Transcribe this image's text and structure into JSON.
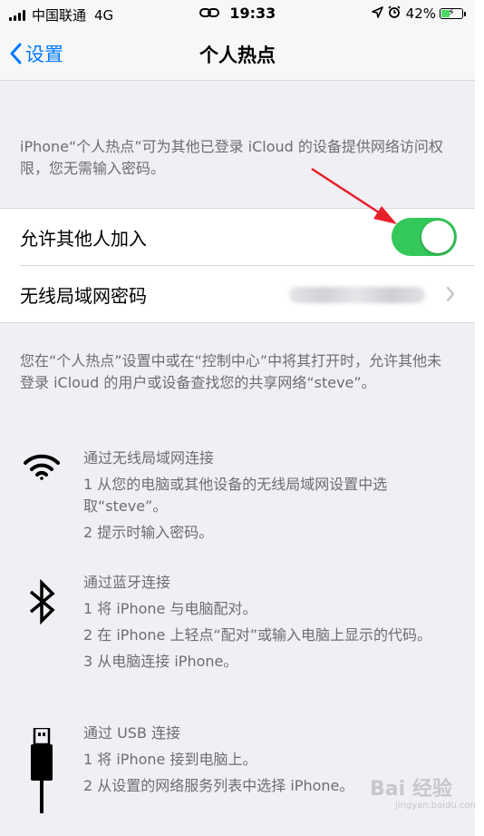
{
  "status_bar": {
    "carrier": "中国联通",
    "network": "4G",
    "time": "19:33",
    "battery": "42%",
    "battery_level": 0.42
  },
  "nav": {
    "back_label": "设置",
    "title": "个人热点"
  },
  "description_top": "iPhone“个人热点”可为其他已登录 iCloud 的设备提供网络访问权限，您无需输入密码。",
  "settings": {
    "allow_others_label": "允许其他人加入",
    "allow_others_on": true,
    "wifi_password_label": "无线局域网密码"
  },
  "description_bottom": "您在“个人热点”设置中或在“控制中心”中将其打开时，允许其他未登录 iCloud 的用户或设备查找您的共享网络“steve”。",
  "methods": {
    "wifi": {
      "icon": "wifi-icon",
      "title": "通过无线局域网连接",
      "steps": [
        "1 从您的电脑或其他设备的无线局域网设置中选取“steve”。",
        "2 提示时输入密码。"
      ]
    },
    "bluetooth": {
      "icon": "bluetooth-icon",
      "title": "通过蓝牙连接",
      "steps": [
        "1 将 iPhone 与电脑配对。",
        "2 在 iPhone 上轻点“配对”或输入电脑上显示的代码。",
        "3 从电脑连接 iPhone。"
      ]
    },
    "usb": {
      "icon": "usb-icon",
      "title": "通过 USB 连接",
      "steps": [
        "1 将 iPhone 接到电脑上。",
        "2 从设置的网络服务列表中选择 iPhone。"
      ]
    }
  },
  "watermark": {
    "text": "Bai 经验",
    "sub": "jingyan.baidu.com"
  },
  "colors": {
    "accent": "#007aff",
    "toggle_on": "#34c759",
    "annotation_arrow": "#e8202a"
  }
}
